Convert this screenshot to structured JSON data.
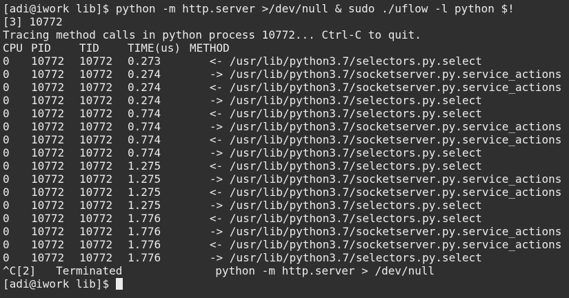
{
  "terminal": {
    "command_line": "[adi@iwork lib]$ python -m http.server >/dev/null & sudo ./uflow -l python $!",
    "job_info": "[3] 10772",
    "tracing_msg": "Tracing method calls in python process 10772... Ctrl-C to quit.",
    "headers": {
      "cpu": "CPU",
      "pid": "PID",
      "tid": "TID",
      "time": "TIME(us)",
      "method": "METHOD"
    },
    "rows": [
      {
        "cpu": "0",
        "pid": "10772",
        "tid": "10772",
        "time": "0.273",
        "method": "   <- /usr/lib/python3.7/selectors.py.select"
      },
      {
        "cpu": "0",
        "pid": "10772",
        "tid": "10772",
        "time": "0.274",
        "method": "   -> /usr/lib/python3.7/socketserver.py.service_actions"
      },
      {
        "cpu": "0",
        "pid": "10772",
        "tid": "10772",
        "time": "0.274",
        "method": "   <- /usr/lib/python3.7/socketserver.py.service_actions"
      },
      {
        "cpu": "0",
        "pid": "10772",
        "tid": "10772",
        "time": "0.274",
        "method": "   -> /usr/lib/python3.7/selectors.py.select"
      },
      {
        "cpu": "0",
        "pid": "10772",
        "tid": "10772",
        "time": "0.774",
        "method": "   <- /usr/lib/python3.7/selectors.py.select"
      },
      {
        "cpu": "0",
        "pid": "10772",
        "tid": "10772",
        "time": "0.774",
        "method": "   -> /usr/lib/python3.7/socketserver.py.service_actions"
      },
      {
        "cpu": "0",
        "pid": "10772",
        "tid": "10772",
        "time": "0.774",
        "method": "   <- /usr/lib/python3.7/socketserver.py.service_actions"
      },
      {
        "cpu": "0",
        "pid": "10772",
        "tid": "10772",
        "time": "0.774",
        "method": "   -> /usr/lib/python3.7/selectors.py.select"
      },
      {
        "cpu": "0",
        "pid": "10772",
        "tid": "10772",
        "time": "1.275",
        "method": "   <- /usr/lib/python3.7/selectors.py.select"
      },
      {
        "cpu": "0",
        "pid": "10772",
        "tid": "10772",
        "time": "1.275",
        "method": "   -> /usr/lib/python3.7/socketserver.py.service_actions"
      },
      {
        "cpu": "0",
        "pid": "10772",
        "tid": "10772",
        "time": "1.275",
        "method": "   <- /usr/lib/python3.7/socketserver.py.service_actions"
      },
      {
        "cpu": "0",
        "pid": "10772",
        "tid": "10772",
        "time": "1.275",
        "method": "   -> /usr/lib/python3.7/selectors.py.select"
      },
      {
        "cpu": "0",
        "pid": "10772",
        "tid": "10772",
        "time": "1.776",
        "method": "   <- /usr/lib/python3.7/selectors.py.select"
      },
      {
        "cpu": "0",
        "pid": "10772",
        "tid": "10772",
        "time": "1.776",
        "method": "   -> /usr/lib/python3.7/socketserver.py.service_actions"
      },
      {
        "cpu": "0",
        "pid": "10772",
        "tid": "10772",
        "time": "1.776",
        "method": "   <- /usr/lib/python3.7/socketserver.py.service_actions"
      },
      {
        "cpu": "0",
        "pid": "10772",
        "tid": "10772",
        "time": "1.776",
        "method": "   -> /usr/lib/python3.7/selectors.py.select"
      }
    ],
    "terminated_line": "^C[2]   Terminated              python -m http.server > /dev/null",
    "prompt": "[adi@iwork lib]$ ",
    "colors": {
      "background": "#2f2f2f",
      "foreground": "#ececec"
    }
  }
}
